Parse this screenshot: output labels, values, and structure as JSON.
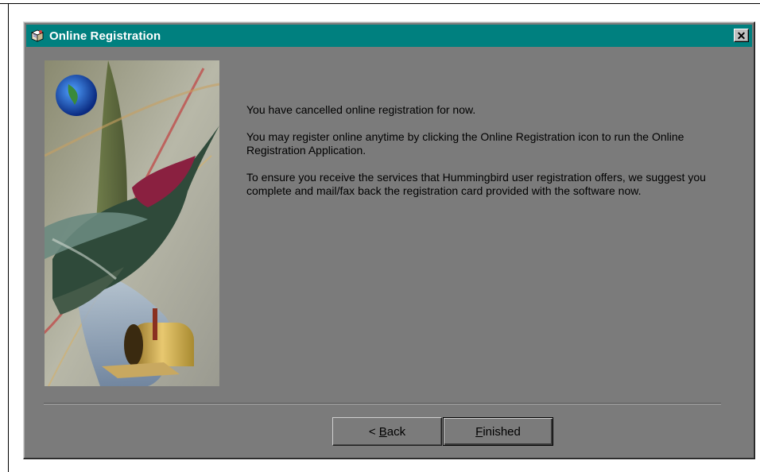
{
  "window": {
    "title": "Online Registration",
    "close_glyph": "✕"
  },
  "message": {
    "line1": "You have cancelled online registration for now.",
    "line2": "You may register online anytime by clicking the Online Registration icon to run the Online Registration Application.",
    "line3": "To ensure you receive the services that Hummingbird user registration offers, we suggest you complete and mail/fax back the registration card provided with the software now."
  },
  "buttons": {
    "back": {
      "prefix": "< ",
      "mnemonic": "B",
      "rest": "ack"
    },
    "finished": {
      "prefix": "",
      "mnemonic": "F",
      "rest": "inished"
    }
  },
  "icons": {
    "title": "registration-book-icon",
    "picture": "hummingbird-mailbox-illustration"
  },
  "colors": {
    "titlebar": "#00807f",
    "dialog_face": "#7b7b7b",
    "title_text": "#ffffff"
  }
}
